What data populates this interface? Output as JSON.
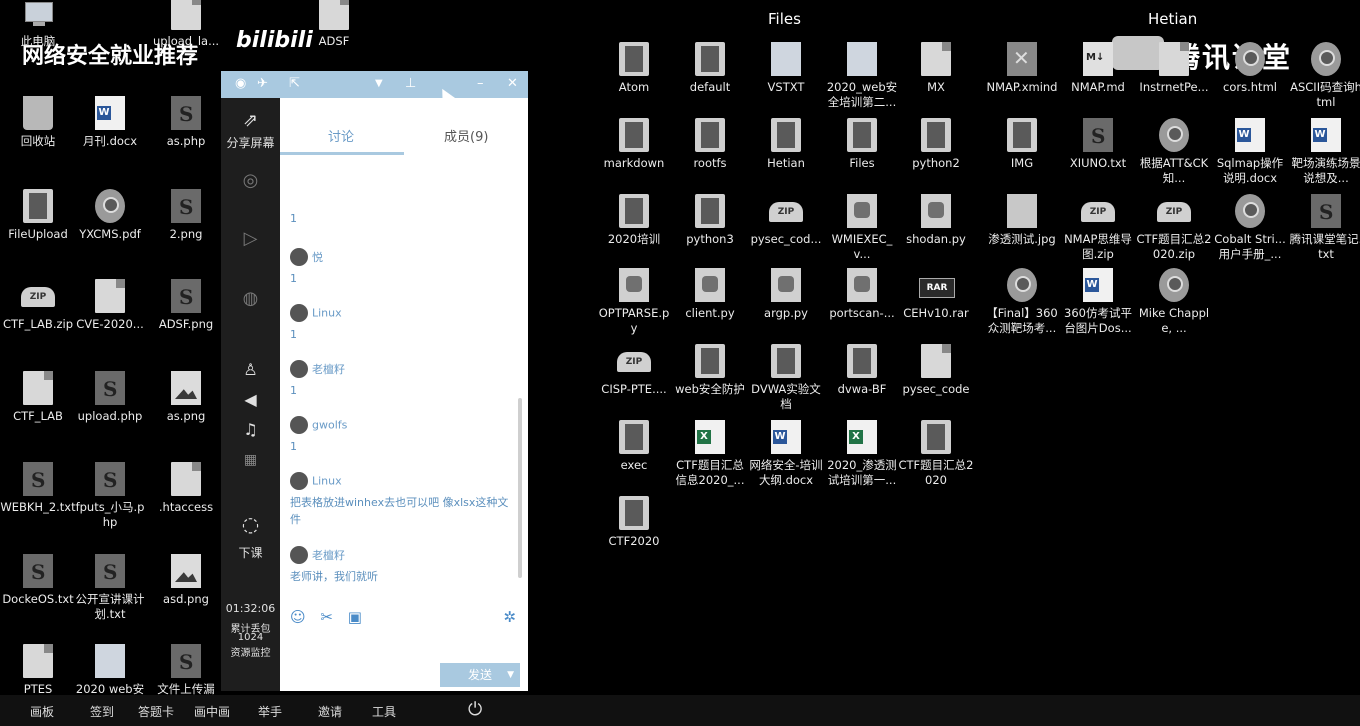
{
  "watermark": {
    "left_text": "网络安全就业推荐",
    "bili": "bilibili",
    "right_text": "腾讯课堂"
  },
  "sections": {
    "files": "Files",
    "hetian": "Hetian"
  },
  "left_icons": [
    {
      "label": "此电脑",
      "icon": "pc"
    },
    {
      "label": "回收站",
      "icon": "bin"
    },
    {
      "label": "月刊.docx",
      "icon": "w-doc"
    },
    {
      "label": "as.php",
      "icon": "php"
    },
    {
      "label": "FileUpload",
      "icon": "folder"
    },
    {
      "label": "YXCMS.pdf",
      "icon": "chrome"
    },
    {
      "label": "2.png",
      "icon": "php"
    },
    {
      "label": "CTF_LAB.zip",
      "icon": "zip"
    },
    {
      "label": "CVE-2020...",
      "icon": "doc"
    },
    {
      "label": "ADSF.png",
      "icon": "php"
    },
    {
      "label": "CTF_LAB",
      "icon": "doc"
    },
    {
      "label": "upload.php",
      "icon": "php"
    },
    {
      "label": "as.png",
      "icon": "img"
    },
    {
      "label": "WEBKH_2.txt",
      "icon": "php"
    },
    {
      "label": "fputs_小马.php",
      "icon": "php"
    },
    {
      "label": ".htaccess",
      "icon": "doc"
    },
    {
      "label": "DockeOS.txt",
      "icon": "php"
    },
    {
      "label": "公开宣讲课计划.txt",
      "icon": "php"
    },
    {
      "label": "asd.png",
      "icon": "img"
    },
    {
      "label": "PTES",
      "icon": "doc"
    },
    {
      "label": "2020 web安",
      "icon": "ts"
    },
    {
      "label": "文件上传漏",
      "icon": "php"
    },
    {
      "label": "upload_la...",
      "icon": "doc"
    },
    {
      "label": "ADSF",
      "icon": "doc"
    }
  ],
  "files_icons": [
    {
      "label": "Atom",
      "icon": "folder"
    },
    {
      "label": "default",
      "icon": "folder"
    },
    {
      "label": "VSTXT",
      "icon": "ts"
    },
    {
      "label": "2020_web安全培训第二...",
      "icon": "ts"
    },
    {
      "label": "MX",
      "icon": "doc"
    },
    {
      "label": "markdown",
      "icon": "folder"
    },
    {
      "label": "rootfs",
      "icon": "folder"
    },
    {
      "label": "Hetian",
      "icon": "folder"
    },
    {
      "label": "Files",
      "icon": "folder"
    },
    {
      "label": "python2",
      "icon": "folder"
    },
    {
      "label": "2020培训",
      "icon": "folder"
    },
    {
      "label": "python3",
      "icon": "folder"
    },
    {
      "label": "pysec_cod...",
      "icon": "zip"
    },
    {
      "label": "WMIEXEC_v...",
      "icon": "py"
    },
    {
      "label": "shodan.py",
      "icon": "py"
    },
    {
      "label": "OPTPARSE.py",
      "icon": "py"
    },
    {
      "label": "client.py",
      "icon": "py"
    },
    {
      "label": "argp.py",
      "icon": "py"
    },
    {
      "label": "portscan-...",
      "icon": "py"
    },
    {
      "label": "CEHv10.rar",
      "icon": "rar"
    },
    {
      "label": "CISP-PTE....",
      "icon": "zip"
    },
    {
      "label": "web安全防护",
      "icon": "folder"
    },
    {
      "label": "DVWA实验文档",
      "icon": "folder"
    },
    {
      "label": "dvwa-BF",
      "icon": "folder"
    },
    {
      "label": "pysec_code",
      "icon": "doc"
    },
    {
      "label": "exec",
      "icon": "folder"
    },
    {
      "label": "CTF题目汇总信息2020_...",
      "icon": "x-doc"
    },
    {
      "label": "网络安全-培训大纲.docx",
      "icon": "w-doc"
    },
    {
      "label": "2020_渗透测试培训第一...",
      "icon": "x-doc"
    },
    {
      "label": "CTF题目汇总2020",
      "icon": "folder"
    },
    {
      "label": "CTF2020",
      "icon": "folder"
    }
  ],
  "hetian_icons": [
    {
      "label": "NMAP.xmind",
      "icon": "mind"
    },
    {
      "label": "NMAP.md",
      "icon": "md"
    },
    {
      "label": "InstrnetPe...",
      "icon": "doc"
    },
    {
      "label": "cors.html",
      "icon": "chrome"
    },
    {
      "label": "ASCII码查询html",
      "icon": "chrome"
    },
    {
      "label": "IMG",
      "icon": "folder"
    },
    {
      "label": "XIUNO.txt",
      "icon": "php"
    },
    {
      "label": "根据ATT&CK知...",
      "icon": "chrome"
    },
    {
      "label": "Sqlmap操作说明.docx",
      "icon": "w-doc"
    },
    {
      "label": "靶场演练场景说想及...",
      "icon": "w-doc"
    },
    {
      "label": "渗透测试.jpg",
      "icon": "jpgwide"
    },
    {
      "label": "NMAP思维导图.zip",
      "icon": "zip"
    },
    {
      "label": "CTF题目汇总2020.zip",
      "icon": "zip"
    },
    {
      "label": "Cobalt Stri...用户手册_...",
      "icon": "chrome"
    },
    {
      "label": "腾讯课堂笔记.txt",
      "icon": "php"
    },
    {
      "label": "【Final】360众测靶场考...",
      "icon": "chrome"
    },
    {
      "label": "360仿考试平台图片Dos...",
      "icon": "w-doc"
    },
    {
      "label": "Mike Chapple, ...",
      "icon": "chrome"
    }
  ],
  "chat": {
    "sidebar": {
      "share_screen": "分享屏幕",
      "end_class": "下课",
      "time": "01:32:06",
      "stat1": "累计丢包",
      "stat2": "1024",
      "stat3": "资源监控"
    },
    "tabs": {
      "discuss": "讨论",
      "members": "成员(9)"
    },
    "messages": [
      {
        "name": "",
        "text": "1"
      },
      {
        "name": "悦",
        "text": "1"
      },
      {
        "name": "Linux",
        "text": "1"
      },
      {
        "name": "老檀籽",
        "text": "1"
      },
      {
        "name": "gwolfs",
        "text": "1"
      },
      {
        "name": "Linux",
        "text": "把表格放进winhex去也可以吧 像xlsx这种文件"
      },
      {
        "name": "老檀籽",
        "text": "老师讲，我们就听"
      }
    ],
    "send": "发送"
  },
  "taskbar": [
    {
      "label": "画板"
    },
    {
      "label": "签到"
    },
    {
      "label": "答题卡"
    },
    {
      "label": "画中画"
    },
    {
      "label": "举手"
    },
    {
      "label": "邀请"
    },
    {
      "label": "工具"
    }
  ]
}
